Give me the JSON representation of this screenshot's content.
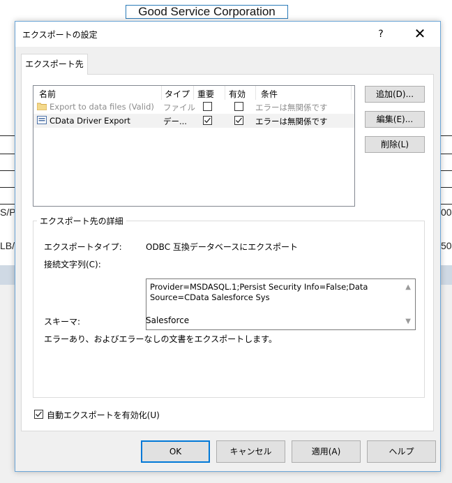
{
  "background": {
    "title": "Good Service Corporation",
    "fragments": [
      "S/PI",
      "LB/(",
      "00",
      "50"
    ]
  },
  "dialog": {
    "title": "エクスポートの設定",
    "help_label": "?",
    "close_label": "✕",
    "tab_label": "エクスポート先",
    "list": {
      "columns": [
        "名前",
        "タイプ",
        "重要",
        "有効",
        "条件"
      ],
      "rows": [
        {
          "name": "Export to data files (Valid)",
          "type": "ファイル",
          "important": false,
          "enabled": false,
          "condition": "エラーは無関係です",
          "selected": false,
          "dimmed": true
        },
        {
          "name": "CData Driver Export",
          "type": "デー...",
          "important": true,
          "enabled": true,
          "condition": "エラーは無関係です",
          "selected": true,
          "dimmed": false
        }
      ]
    },
    "side_buttons": {
      "add": "追加(D)...",
      "edit": "編集(E)...",
      "delete": "削除(L)"
    },
    "details": {
      "group_title": "エクスポート先の詳細",
      "export_type_label": "エクスポートタイプ:",
      "export_type_value": "ODBC 互換データベースにエクスポート",
      "connection_label": "接続文字列(C):",
      "connection_value": "Provider=MSDASQL.1;Persist Security Info=False;Data Source=CData Salesforce Sys",
      "schema_label": "スキーマ:",
      "schema_value": "Salesforce",
      "description": "エラーあり、およびエラーなしの文書をエクスポートします。"
    },
    "auto_export": {
      "label": "自動エクスポートを有効化(U)",
      "checked": true
    },
    "buttons": {
      "ok": "OK",
      "cancel": "キャンセル",
      "apply": "適用(A)",
      "help": "ヘルプ"
    }
  },
  "colors": {
    "accent": "#0078d7",
    "dialog_bg": "#f0f0f0",
    "selected_row": "#f2f2f2",
    "folder": "#e8c26a"
  }
}
